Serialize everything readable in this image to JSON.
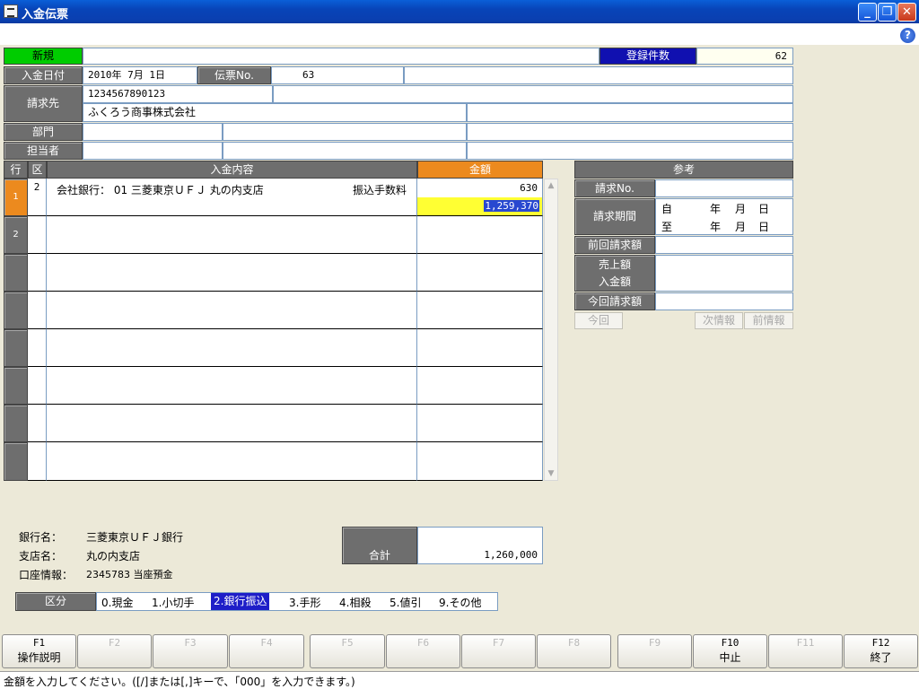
{
  "window": {
    "title": "入金伝票"
  },
  "top": {
    "mode_label": "新規",
    "count_label": "登録件数",
    "count_value": "62"
  },
  "header": {
    "date_label": "入金日付",
    "date_value": "2010年 7月 1日",
    "voucher_label": "伝票No.",
    "voucher_value": "63",
    "billto_label": "請求先",
    "billto_code": "1234567890123",
    "billto_name": "ふくろう商事株式会社",
    "dept_label": "部門",
    "staff_label": "担当者"
  },
  "grid": {
    "col_row": "行",
    "col_kubun": "区",
    "col_content": "入金内容",
    "col_amount": "金額",
    "rows": [
      {
        "num": "1",
        "kubun": "2",
        "content": "会社銀行： 01 三菱東京ＵＦＪ 丸の内支店",
        "fee_label": "振込手数料",
        "amount": "630",
        "amount2": "1,259,370"
      },
      {
        "num": "2",
        "kubun": "",
        "content": "",
        "fee_label": "",
        "amount": "",
        "amount2": ""
      },
      {
        "num": "",
        "kubun": "",
        "content": "",
        "fee_label": "",
        "amount": "",
        "amount2": ""
      },
      {
        "num": "",
        "kubun": "",
        "content": "",
        "fee_label": "",
        "amount": "",
        "amount2": ""
      },
      {
        "num": "",
        "kubun": "",
        "content": "",
        "fee_label": "",
        "amount": "",
        "amount2": ""
      },
      {
        "num": "",
        "kubun": "",
        "content": "",
        "fee_label": "",
        "amount": "",
        "amount2": ""
      },
      {
        "num": "",
        "kubun": "",
        "content": "",
        "fee_label": "",
        "amount": "",
        "amount2": ""
      },
      {
        "num": "",
        "kubun": "",
        "content": "",
        "fee_label": "",
        "amount": "",
        "amount2": ""
      }
    ]
  },
  "ref": {
    "title": "参考",
    "invoice_no_label": "請求No.",
    "period_label": "請求期間",
    "from_label": "自",
    "to_label": "至",
    "ymd": [
      "年",
      "月",
      "日"
    ],
    "prev_label": "前回請求額",
    "sales_label": "売上額",
    "received_label": "入金額",
    "current_label": "今回請求額",
    "btn_now": "今回",
    "btn_next": "次情報",
    "btn_prev": "前情報"
  },
  "bank": {
    "bank_label": "銀行名：",
    "bank_value": "三菱東京ＵＦＪ銀行",
    "branch_label": "支店名：",
    "branch_value": "丸の内支店",
    "account_label": "口座情報：",
    "account_value": "2345783 当座預金"
  },
  "total": {
    "label": "合計",
    "value": "1,260,000"
  },
  "kubun": {
    "label": "区分",
    "options": [
      "0.現金",
      "1.小切手",
      "2.銀行振込",
      "3.手形",
      "4.相殺",
      "5.値引",
      "9.その他"
    ],
    "selected": "2.銀行振込"
  },
  "fkeys": [
    {
      "key": "F1",
      "label": "操作説明",
      "enabled": true
    },
    {
      "key": "F2",
      "label": "",
      "enabled": false
    },
    {
      "key": "F3",
      "label": "",
      "enabled": false
    },
    {
      "key": "F4",
      "label": "",
      "enabled": false
    },
    {
      "key": "F5",
      "label": "",
      "enabled": false
    },
    {
      "key": "F6",
      "label": "",
      "enabled": false
    },
    {
      "key": "F7",
      "label": "",
      "enabled": false
    },
    {
      "key": "F8",
      "label": "",
      "enabled": false
    },
    {
      "key": "F9",
      "label": "",
      "enabled": false
    },
    {
      "key": "F10",
      "label": "中止",
      "enabled": true
    },
    {
      "key": "F11",
      "label": "",
      "enabled": false
    },
    {
      "key": "F12",
      "label": "終了",
      "enabled": true
    }
  ],
  "status": "金額を入力してください。([/]または[,]キーで、「000」を入力できます。)",
  "colors": {
    "mode_bg": "#00cc00",
    "count_bg": "#1010b0",
    "active_row": "#ec8a1e",
    "amount_hdr": "#ec8a1e",
    "input_highlight": "#ffff33",
    "kubun_selected": "#1e1ec8"
  }
}
